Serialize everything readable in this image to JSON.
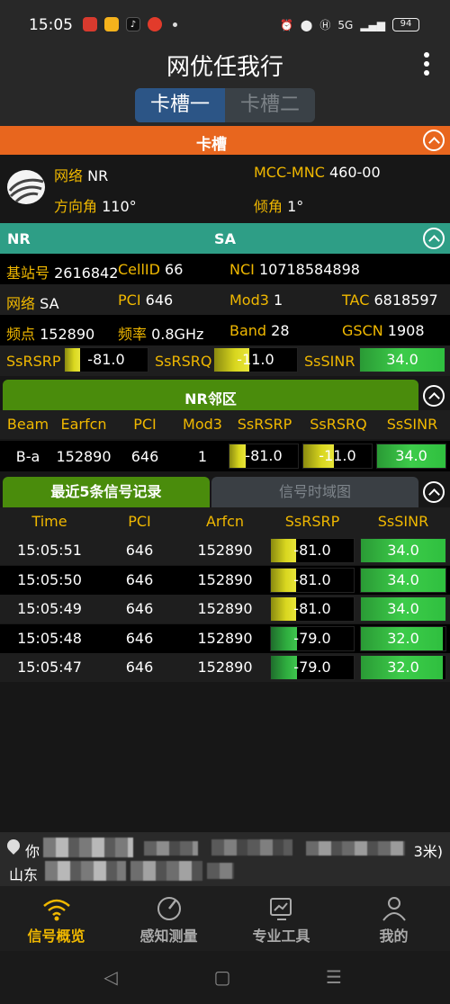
{
  "status_bar": {
    "time": "15:05",
    "network": "5G",
    "battery": "94"
  },
  "header": {
    "title": "网优任我行"
  },
  "slot_tabs": [
    "卡槽一",
    "卡槽二"
  ],
  "card_section": {
    "title": "卡槽",
    "network_label": "网络",
    "network_value": "NR",
    "mcc_label": "MCC-MNC",
    "mcc_value": "460-00",
    "azimuth_label": "方向角",
    "azimuth_value": "110°",
    "tilt_label": "倾角",
    "tilt_value": "1°"
  },
  "nr_section": {
    "left_title": "NR",
    "center_title": "SA",
    "base_label": "基站号",
    "base_value": "2616842",
    "cellid_label": "CellID",
    "cellid_value": "66",
    "nci_label": "NCI",
    "nci_value": "10718584898",
    "net_label": "网络",
    "net_value": "SA",
    "pci_label": "PCI",
    "pci_value": "646",
    "mod3_label": "Mod3",
    "mod3_value": "1",
    "tac_label": "TAC",
    "tac_value": "6818597",
    "freq_pt_label": "频点",
    "freq_pt_value": "152890",
    "freq_label": "频率",
    "freq_value": "0.8GHz",
    "band_label": "Band",
    "band_value": "28",
    "gscn_label": "GSCN",
    "gscn_value": "1908",
    "ssrsrp_label": "SsRSRP",
    "ssrsrp_value": "-81.0",
    "ssrsrp_level": 0.18,
    "ssrsrq_label": "SsRSRQ",
    "ssrsrq_value": "-11.0",
    "ssrsrq_level": 0.42,
    "sssinr_label": "SsSINR",
    "sssinr_value": "34.0",
    "sssinr_level": 1.0
  },
  "neighbor": {
    "title": "NR邻区",
    "headers": [
      "Beam",
      "Earfcn",
      "PCI",
      "Mod3",
      "SsRSRP",
      "SsRSRQ",
      "SsSINR"
    ],
    "row": {
      "beam": "B-a",
      "earfcn": "152890",
      "pci": "646",
      "mod3": "1",
      "ssrsrp": "-81.0",
      "ssrsrp_level": 0.24,
      "ssrsrq": "-11.0",
      "ssrsrq_level": 0.45,
      "sssinr": "34.0",
      "sssinr_level": 1.0
    }
  },
  "records": {
    "tab_active": "最近5条信号记录",
    "tab_inactive": "信号时域图",
    "headers": [
      "Time",
      "PCI",
      "Arfcn",
      "SsRSRP",
      "SsSINR"
    ],
    "rows": [
      {
        "time": "15:05:51",
        "pci": "646",
        "arfcn": "152890",
        "ssrsrp": "-81.0",
        "rsrp_level": 0.3,
        "rsrp_color": "yellow",
        "sssinr": "34.0",
        "sinr_level": 1.0
      },
      {
        "time": "15:05:50",
        "pci": "646",
        "arfcn": "152890",
        "ssrsrp": "-81.0",
        "rsrp_level": 0.3,
        "rsrp_color": "yellow",
        "sssinr": "34.0",
        "sinr_level": 1.0
      },
      {
        "time": "15:05:49",
        "pci": "646",
        "arfcn": "152890",
        "ssrsrp": "-81.0",
        "rsrp_level": 0.3,
        "rsrp_color": "yellow",
        "sssinr": "34.0",
        "sinr_level": 1.0
      },
      {
        "time": "15:05:48",
        "pci": "646",
        "arfcn": "152890",
        "ssrsrp": "-79.0",
        "rsrp_level": 0.32,
        "rsrp_color": "green",
        "sssinr": "32.0",
        "sinr_level": 0.97
      },
      {
        "time": "15:05:47",
        "pci": "646",
        "arfcn": "152890",
        "ssrsrp": "-79.0",
        "rsrp_level": 0.32,
        "rsrp_color": "green",
        "sssinr": "32.0",
        "sinr_level": 0.97
      }
    ]
  },
  "location": {
    "line1_prefix": "你",
    "line1_suffix": "3米)",
    "line2_prefix": "山东"
  },
  "bottom_nav": [
    "信号概览",
    "感知测量",
    "专业工具",
    "我的"
  ],
  "colors": {
    "orange": "#e8661e",
    "teal": "#2e9e86",
    "green_header": "#4a8c0c",
    "label_yellow": "#f0b800"
  }
}
